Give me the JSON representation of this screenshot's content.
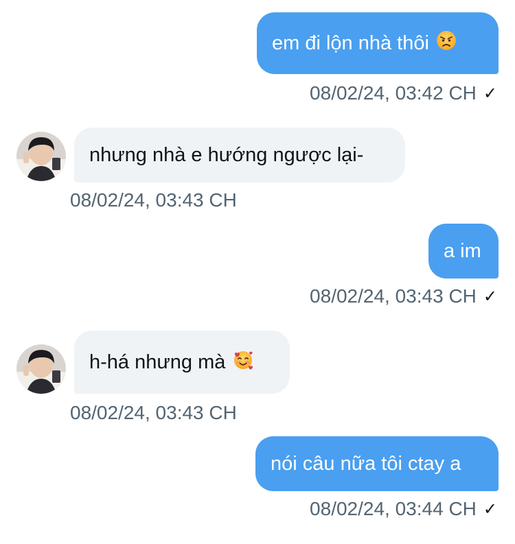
{
  "messages": [
    {
      "direction": "out",
      "text": "em đi lộn nhà thôi",
      "emoji": "angry-face",
      "timestamp": "08/02/24, 03:42 CH",
      "read_mark": "✓"
    },
    {
      "direction": "in",
      "text": "nhưng nhà e hướng ngược lại-",
      "timestamp": "08/02/24, 03:43 CH"
    },
    {
      "direction": "out",
      "text": "a im",
      "timestamp": "08/02/24, 03:43 CH",
      "read_mark": "✓"
    },
    {
      "direction": "in",
      "text": "h-há nhưng mà",
      "emoji": "smiling-face-with-hearts",
      "timestamp": "08/02/24, 03:43 CH"
    },
    {
      "direction": "out",
      "text": "nói câu nữa tôi ctay a",
      "timestamp": "08/02/24, 03:44 CH",
      "read_mark": "✓"
    }
  ],
  "colors": {
    "outgoing_bubble": "#4a9ff0",
    "incoming_bubble": "#eff3f6",
    "timestamp_text": "#536471",
    "message_text": "#0f1419"
  },
  "icons": {
    "sender_avatar": "avatar",
    "read_receipt": "check-icon"
  }
}
